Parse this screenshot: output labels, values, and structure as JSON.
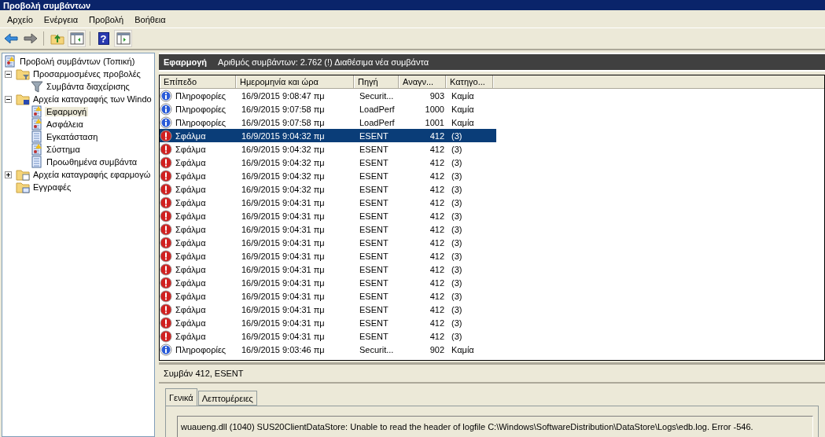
{
  "window": {
    "title": "Προβολή συμβάντων"
  },
  "menu": [
    "Αρχείο",
    "Ενέργεια",
    "Προβολή",
    "Βοήθεια"
  ],
  "toolbar": [
    {
      "kind": "back",
      "pressed": false
    },
    {
      "kind": "forward",
      "pressed": false
    },
    {
      "kind": "sep"
    },
    {
      "kind": "up",
      "pressed": false
    },
    {
      "kind": "pane",
      "pressed": true
    },
    {
      "kind": "sep"
    },
    {
      "kind": "help",
      "label": "?",
      "pressed": false
    },
    {
      "kind": "pane2",
      "pressed": true
    }
  ],
  "tree": [
    {
      "label": "Προβολή συμβάντων (Τοπική)",
      "kind": "viewer",
      "selected": false,
      "children": [
        {
          "label": "Προσαρμοσμένες προβολές",
          "kind": "folder-filter",
          "expanded": true,
          "selected": false,
          "children": [
            {
              "label": "Συμβάντα διαχείρισης",
              "kind": "filter",
              "selected": false
            }
          ]
        },
        {
          "label": "Αρχεία καταγραφής των Windo",
          "kind": "folder-win",
          "expanded": true,
          "selected": false,
          "children": [
            {
              "label": "Εφαρμογή",
              "kind": "log-warn",
              "selected": true
            },
            {
              "label": "Ασφάλεια",
              "kind": "log-warn",
              "selected": false
            },
            {
              "label": "Εγκατάσταση",
              "kind": "log",
              "selected": false
            },
            {
              "label": "Σύστημα",
              "kind": "log-warn",
              "selected": false
            },
            {
              "label": "Προωθημένα συμβάντα",
              "kind": "log",
              "selected": false
            }
          ]
        },
        {
          "label": "Αρχεία καταγραφής εφαρμογώ",
          "kind": "folder-app",
          "expanded": false,
          "selected": false
        },
        {
          "label": "Εγγραφές",
          "kind": "folder-sub",
          "selected": false
        }
      ]
    }
  ],
  "header": {
    "title": "Εφαρμογή",
    "info": "Αριθμός συμβάντων: 2.762 (!) Διαθέσιμα νέα συμβάντα"
  },
  "table": {
    "columns": [
      "Επίπεδο",
      "Ημερομηνία και ώρα",
      "Πηγή",
      "Αναγν...",
      "Κατηγο..."
    ],
    "rows": [
      {
        "kind": "info",
        "selected": false,
        "cells": [
          "Πληροφορίες",
          "16/9/2015 9:08:47 πμ",
          "Securit...",
          "903",
          "Καμία"
        ]
      },
      {
        "kind": "info",
        "selected": false,
        "cells": [
          "Πληροφορίες",
          "16/9/2015 9:07:58 πμ",
          "LoadPerf",
          "1000",
          "Καμία"
        ]
      },
      {
        "kind": "info",
        "selected": false,
        "cells": [
          "Πληροφορίες",
          "16/9/2015 9:07:58 πμ",
          "LoadPerf",
          "1001",
          "Καμία"
        ]
      },
      {
        "kind": "error",
        "selected": true,
        "cells": [
          "Σφάλμα",
          "16/9/2015 9:04:32 πμ",
          "ESENT",
          "412",
          "(3)"
        ]
      },
      {
        "kind": "error",
        "selected": false,
        "cells": [
          "Σφάλμα",
          "16/9/2015 9:04:32 πμ",
          "ESENT",
          "412",
          "(3)"
        ]
      },
      {
        "kind": "error",
        "selected": false,
        "cells": [
          "Σφάλμα",
          "16/9/2015 9:04:32 πμ",
          "ESENT",
          "412",
          "(3)"
        ]
      },
      {
        "kind": "error",
        "selected": false,
        "cells": [
          "Σφάλμα",
          "16/9/2015 9:04:32 πμ",
          "ESENT",
          "412",
          "(3)"
        ]
      },
      {
        "kind": "error",
        "selected": false,
        "cells": [
          "Σφάλμα",
          "16/9/2015 9:04:32 πμ",
          "ESENT",
          "412",
          "(3)"
        ]
      },
      {
        "kind": "error",
        "selected": false,
        "cells": [
          "Σφάλμα",
          "16/9/2015 9:04:31 πμ",
          "ESENT",
          "412",
          "(3)"
        ]
      },
      {
        "kind": "error",
        "selected": false,
        "cells": [
          "Σφάλμα",
          "16/9/2015 9:04:31 πμ",
          "ESENT",
          "412",
          "(3)"
        ]
      },
      {
        "kind": "error",
        "selected": false,
        "cells": [
          "Σφάλμα",
          "16/9/2015 9:04:31 πμ",
          "ESENT",
          "412",
          "(3)"
        ]
      },
      {
        "kind": "error",
        "selected": false,
        "cells": [
          "Σφάλμα",
          "16/9/2015 9:04:31 πμ",
          "ESENT",
          "412",
          "(3)"
        ]
      },
      {
        "kind": "error",
        "selected": false,
        "cells": [
          "Σφάλμα",
          "16/9/2015 9:04:31 πμ",
          "ESENT",
          "412",
          "(3)"
        ]
      },
      {
        "kind": "error",
        "selected": false,
        "cells": [
          "Σφάλμα",
          "16/9/2015 9:04:31 πμ",
          "ESENT",
          "412",
          "(3)"
        ]
      },
      {
        "kind": "error",
        "selected": false,
        "cells": [
          "Σφάλμα",
          "16/9/2015 9:04:31 πμ",
          "ESENT",
          "412",
          "(3)"
        ]
      },
      {
        "kind": "error",
        "selected": false,
        "cells": [
          "Σφάλμα",
          "16/9/2015 9:04:31 πμ",
          "ESENT",
          "412",
          "(3)"
        ]
      },
      {
        "kind": "error",
        "selected": false,
        "cells": [
          "Σφάλμα",
          "16/9/2015 9:04:31 πμ",
          "ESENT",
          "412",
          "(3)"
        ]
      },
      {
        "kind": "error",
        "selected": false,
        "cells": [
          "Σφάλμα",
          "16/9/2015 9:04:31 πμ",
          "ESENT",
          "412",
          "(3)"
        ]
      },
      {
        "kind": "error",
        "selected": false,
        "cells": [
          "Σφάλμα",
          "16/9/2015 9:04:31 πμ",
          "ESENT",
          "412",
          "(3)"
        ]
      },
      {
        "kind": "info",
        "selected": false,
        "cells": [
          "Πληροφορίες",
          "16/9/2015 9:03:46 πμ",
          "Securit...",
          "902",
          "Καμία"
        ]
      }
    ]
  },
  "detail": {
    "title": "Συμβάν 412, ESENT",
    "tabs": [
      {
        "label": "Γενικά",
        "selected": true
      },
      {
        "label": "Λεπτομέρειες",
        "selected": false
      }
    ],
    "message": "wuaueng.dll (1040) SUS20ClientDataStore: Unable to read the header of logfile C:\\Windows\\SoftwareDistribution\\DataStore\\Logs\\edb.log. Error -546."
  }
}
